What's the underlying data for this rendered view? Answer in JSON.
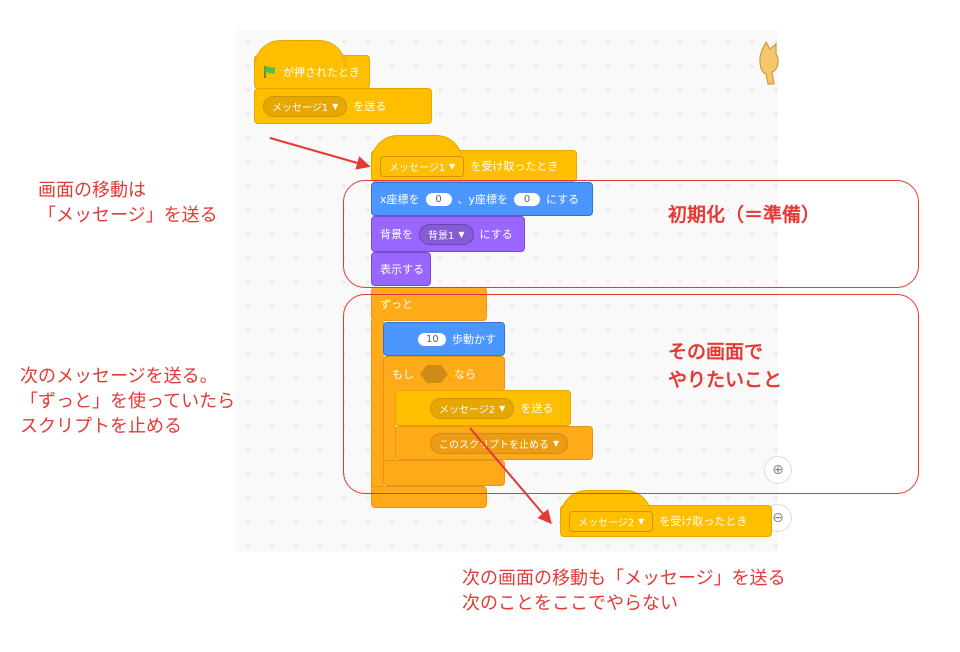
{
  "blocks": {
    "flag_hat": {
      "label": "が押されたとき"
    },
    "broadcast1": {
      "message": "メッセージ1",
      "suffix": "を送る"
    },
    "receive1": {
      "message": "メッセージ1",
      "suffix": "を受け取ったとき"
    },
    "goto_xy": {
      "x_prefix": "x座標を",
      "x_value": "0",
      "y_prefix": "、y座標を",
      "y_value": "0",
      "suffix": "にする"
    },
    "switch_backdrop": {
      "prefix": "背景を",
      "value": "背景1",
      "suffix": "にする"
    },
    "show": {
      "label": "表示する"
    },
    "forever": {
      "label": "ずっと"
    },
    "move": {
      "value": "10",
      "suffix": "歩動かす"
    },
    "if_block": {
      "prefix": "もし",
      "suffix": "なら"
    },
    "broadcast2": {
      "message": "メッセージ2",
      "suffix": "を送る"
    },
    "stop": {
      "value": "このスクリプトを止める"
    },
    "receive2": {
      "message": "メッセージ2",
      "suffix": "を受け取ったとき"
    }
  },
  "annotations": {
    "left1": [
      "画面の移動は",
      "「メッセージ」を送る"
    ],
    "left2": [
      "次のメッセージを送る。",
      "「ずっと」を使っていたら",
      "スクリプトを止める"
    ],
    "init": "初期化（＝準備）",
    "main": [
      "その画面で",
      "やりたいこと"
    ],
    "bottom": [
      "次の画面の移動も「メッセージ」を送る",
      "次のことをここでやらない"
    ]
  },
  "colors": {
    "annotation": "#e53935",
    "events": "#ffbf00",
    "control": "#ffab19",
    "motion": "#4c97ff",
    "looks": "#9966ff"
  }
}
